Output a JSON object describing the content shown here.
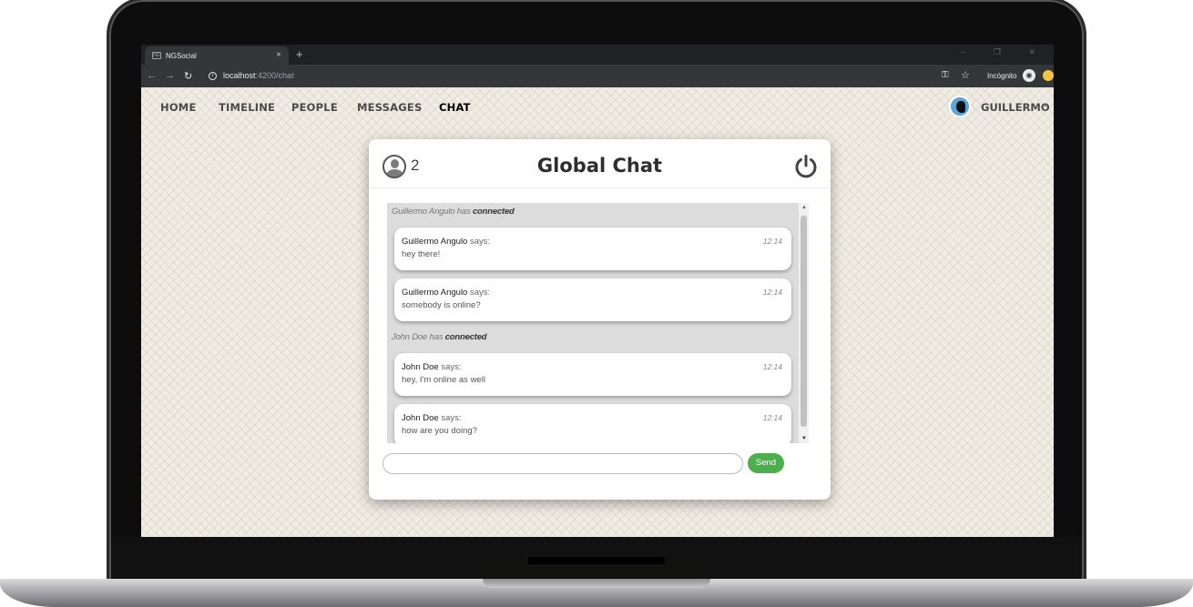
{
  "browser": {
    "tab_favicon": "NG",
    "tab_title": "NGSocial",
    "tab_close": "×",
    "new_tab": "+",
    "url_host": "localhost",
    "url_path": ":4200/chat",
    "incognito_label": "Incógnito",
    "window_controls": "–  ❐  ✕"
  },
  "nav": {
    "items": [
      {
        "label": "HOME",
        "active": false
      },
      {
        "label": "TIMELINE",
        "active": false
      },
      {
        "label": "PEOPLE",
        "active": false
      },
      {
        "label": "MESSAGES",
        "active": false
      },
      {
        "label": "CHAT",
        "active": true
      }
    ],
    "user_name": "GUILLERMO",
    "user_caret": "▾"
  },
  "chat": {
    "title": "Global Chat",
    "online_count": "2",
    "system_messages": [
      {
        "user": "Guillermo Angulo",
        "text": "has",
        "action": "connected"
      },
      {
        "user": "John Doe",
        "text": "has",
        "action": "connected"
      }
    ],
    "messages": [
      {
        "author": "Guillermo Angulo",
        "says": "says:",
        "time": "12:14",
        "text": "hey there!"
      },
      {
        "author": "Guillermo Angulo",
        "says": "says:",
        "time": "12:14",
        "text": "somebody is online?"
      },
      {
        "author": "John Doe",
        "says": "says:",
        "time": "12:14",
        "text": "hey, I'm online as well"
      },
      {
        "author": "John Doe",
        "says": "says:",
        "time": "12:14",
        "text": "how are you doing?"
      }
    ],
    "input_value": "",
    "send_label": "Send",
    "accent_color": "#4cae4c"
  }
}
